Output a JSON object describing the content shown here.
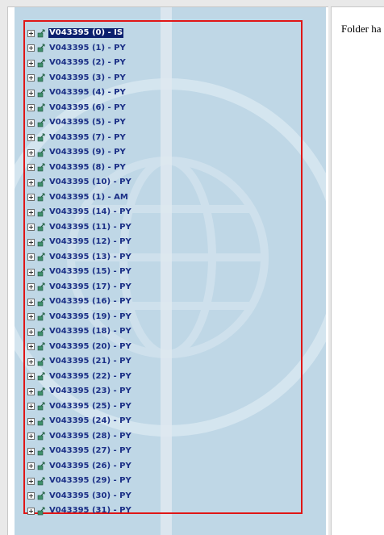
{
  "tree": {
    "items": [
      {
        "label": "V043395 (0) - IS",
        "selected": true
      },
      {
        "label": "V043395 (1) - PY"
      },
      {
        "label": "V043395 (2) - PY"
      },
      {
        "label": "V043395 (3) - PY"
      },
      {
        "label": "V043395 (4) - PY"
      },
      {
        "label": "V043395 (6) - PY"
      },
      {
        "label": "V043395 (5) - PY"
      },
      {
        "label": "V043395 (7) - PY"
      },
      {
        "label": "V043395 (9) - PY"
      },
      {
        "label": "V043395 (8) - PY"
      },
      {
        "label": "V043395 (10) - PY"
      },
      {
        "label": "V043395 (1) - AM"
      },
      {
        "label": "V043395 (14) - PY"
      },
      {
        "label": "V043395 (11) - PY"
      },
      {
        "label": "V043395 (12) - PY"
      },
      {
        "label": "V043395 (13) - PY"
      },
      {
        "label": "V043395 (15) - PY"
      },
      {
        "label": "V043395 (17) - PY"
      },
      {
        "label": "V043395 (16) - PY"
      },
      {
        "label": "V043395 (19) - PY"
      },
      {
        "label": "V043395 (18) - PY"
      },
      {
        "label": "V043395 (20) - PY"
      },
      {
        "label": "V043395 (21) - PY"
      },
      {
        "label": "V043395 (22) - PY"
      },
      {
        "label": "V043395 (23) - PY"
      },
      {
        "label": "V043395 (25) - PY"
      },
      {
        "label": "V043395 (24) - PY"
      },
      {
        "label": "V043395 (28) - PY"
      },
      {
        "label": "V043395 (27) - PY"
      },
      {
        "label": "V043395 (26) - PY"
      },
      {
        "label": "V043395 (29) - PY"
      },
      {
        "label": "V043395 (30) - PY"
      },
      {
        "label": "V043395 (31) - PY"
      }
    ],
    "expander_icon": "plus-box-icon",
    "node_icon": "folder-arrow-icon"
  },
  "content": {
    "message": "Folder ha"
  },
  "colors": {
    "panel_background": "#bfd7e6",
    "highlight_border": "#e01616",
    "label_text": "#1b2f86",
    "selected_background": "#0b1f6e",
    "selected_text": "#ffffff"
  }
}
